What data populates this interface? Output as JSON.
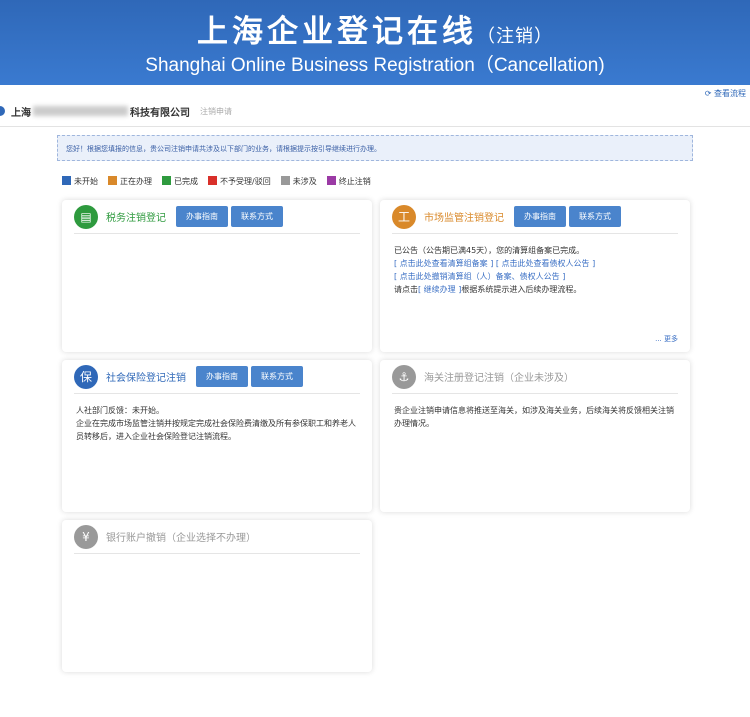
{
  "header": {
    "title": "上海企业登记在线",
    "title_suffix": "（注销）",
    "subtitle": "Shanghai Online Business Registration（Cancellation)"
  },
  "view_flow": "查看流程",
  "company": {
    "prefix": "上海",
    "suffix": "科技有限公司",
    "sub": "注销申请"
  },
  "notice": "您好！根据您填报的信息，贵公司注销申请共涉及以下部门的业务，请根据提示按引导继续进行办理。",
  "legend": [
    {
      "label": "未开始",
      "color": "#2f68b8"
    },
    {
      "label": "正在办理",
      "color": "#d9892a"
    },
    {
      "label": "已完成",
      "color": "#2e9a3e"
    },
    {
      "label": "不予受理/驳回",
      "color": "#d9302a"
    },
    {
      "label": "未涉及",
      "color": "#999999"
    },
    {
      "label": "终止注销",
      "color": "#9b3aa5"
    }
  ],
  "buttons": {
    "guide": "办事指南",
    "contact": "联系方式"
  },
  "cards": {
    "tax": {
      "name": "税务注销登记",
      "color": "#2e9a3e",
      "icon": "document-icon"
    },
    "market": {
      "name": "市场监管注销登记",
      "color": "#d9892a",
      "line1": "已公告（公告期已满45天），您的清算组备案已完成。",
      "link1": "点击此处查看清算组备案",
      "link2": "点击此处查看债权人公告",
      "link3": "点击此处撤销清算组（人）备案、债权人公告",
      "line2a": "请点击",
      "link4": "继续办理",
      "line2b": "根据系统提示进入后续办理流程。",
      "more": "... 更多"
    },
    "social": {
      "name": "社会保险登记注销",
      "color": "#2f68b8",
      "line1": "人社部门反馈：未开始。",
      "line2": "企业在完成市场监管注销并按规定完成社会保险费清缴及所有参保职工和养老人员转移后，进入企业社会保险登记注销流程。"
    },
    "customs": {
      "name": "海关注册登记注销（企业未涉及）",
      "color": "#999999",
      "line1": "贵企业注销申请信息将推送至海关，如涉及海关业务，后续海关将反馈相关注销办理情况。"
    },
    "bank": {
      "name": "银行账户撤销（企业选择不办理）",
      "color": "#999999"
    }
  }
}
